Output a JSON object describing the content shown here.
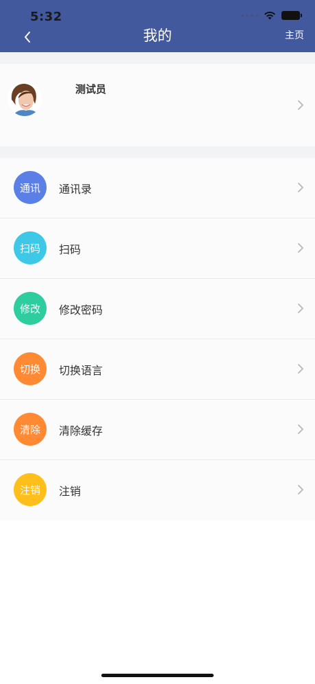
{
  "status_bar": {
    "time": "5:32"
  },
  "nav": {
    "title": "我的",
    "home_label": "主页"
  },
  "profile": {
    "username": "测试员"
  },
  "menu": [
    {
      "icon_text": "通讯",
      "label": "通讯录",
      "color": "#5a7fe6"
    },
    {
      "icon_text": "扫码",
      "label": "扫码",
      "color": "#3cc8e6"
    },
    {
      "icon_text": "修改",
      "label": "修改密码",
      "color": "#2ecda0"
    },
    {
      "icon_text": "切换",
      "label": "切换语言",
      "color": "#ff8a33"
    },
    {
      "icon_text": "清除",
      "label": "清除缓存",
      "color": "#ff8a33"
    },
    {
      "icon_text": "注销",
      "label": "注销",
      "color": "#ffbf1a"
    }
  ],
  "colors": {
    "header": "#43599e",
    "background": "#f2f3f5"
  }
}
